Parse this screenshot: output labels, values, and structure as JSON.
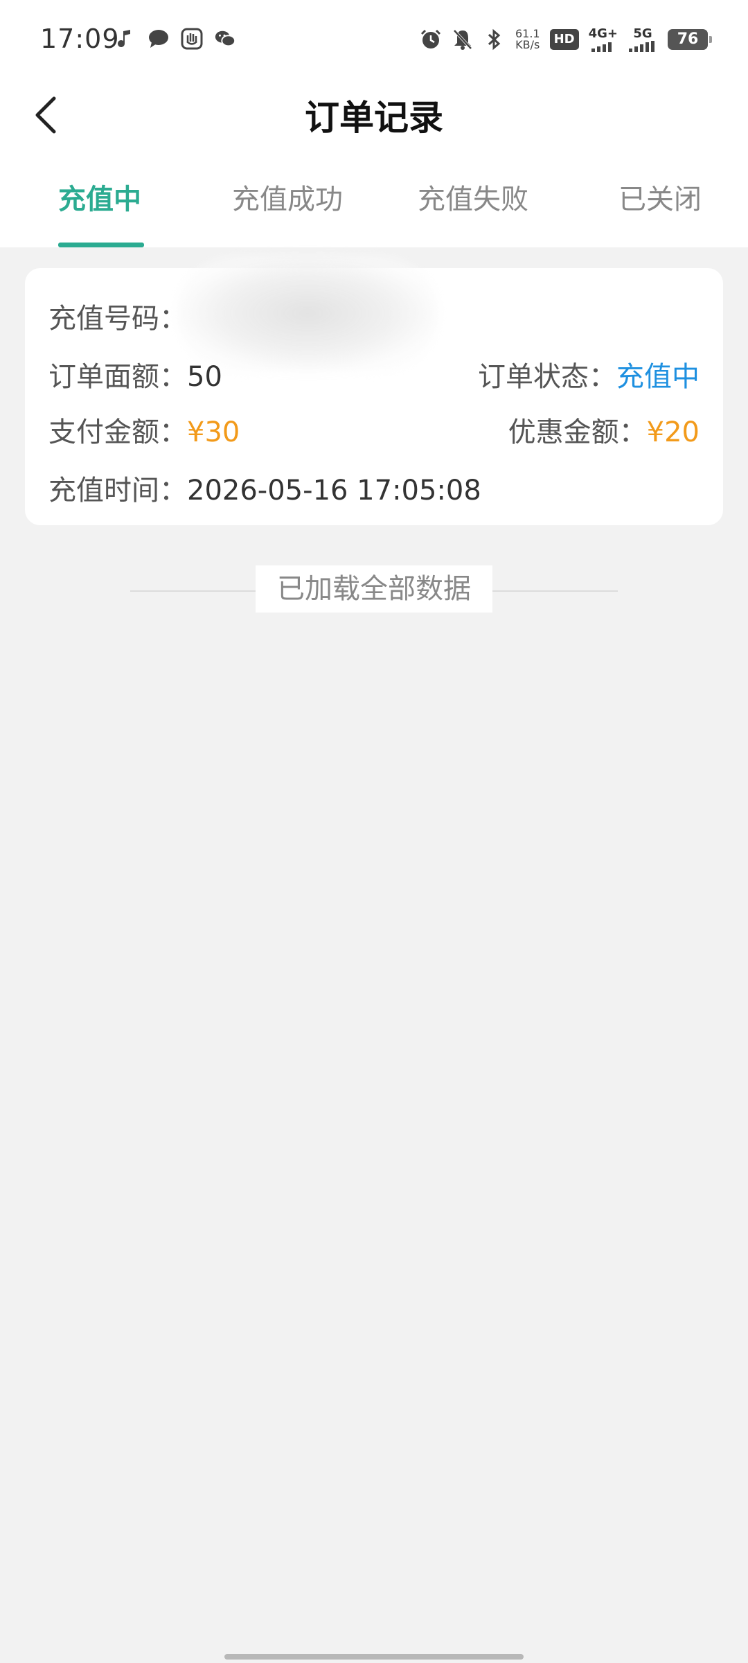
{
  "status_bar": {
    "time": "17:09",
    "left_icons": [
      "music-icon",
      "message-bubble-icon",
      "hand-icon",
      "wechat-icon"
    ],
    "speed_value": "61.1",
    "speed_unit": "KB/s",
    "hd_label": "HD",
    "network_4g": "4G+",
    "network_5g": "5G",
    "battery": "76"
  },
  "header": {
    "title": "订单记录"
  },
  "tabs": [
    {
      "label": "充值中",
      "active": true
    },
    {
      "label": "充值成功",
      "active": false
    },
    {
      "label": "充值失败",
      "active": false
    },
    {
      "label": "已关闭",
      "active": false
    }
  ],
  "order": {
    "phone_label": "充值号码：",
    "phone_value": "",
    "face_value_label": "订单面额：",
    "face_value": "50",
    "status_label": "订单状态：",
    "status_value": "充值中",
    "paid_label": "支付金额：",
    "paid_value": "¥30",
    "discount_label": "优惠金额：",
    "discount_value": "¥20",
    "time_label": "充值时间：",
    "time_value": "2026-05-16 17:05:08"
  },
  "footer": {
    "loaded_text": "已加载全部数据"
  },
  "colors": {
    "accent": "#2bab91",
    "price": "#f29a1a",
    "status": "#1e90e0"
  }
}
